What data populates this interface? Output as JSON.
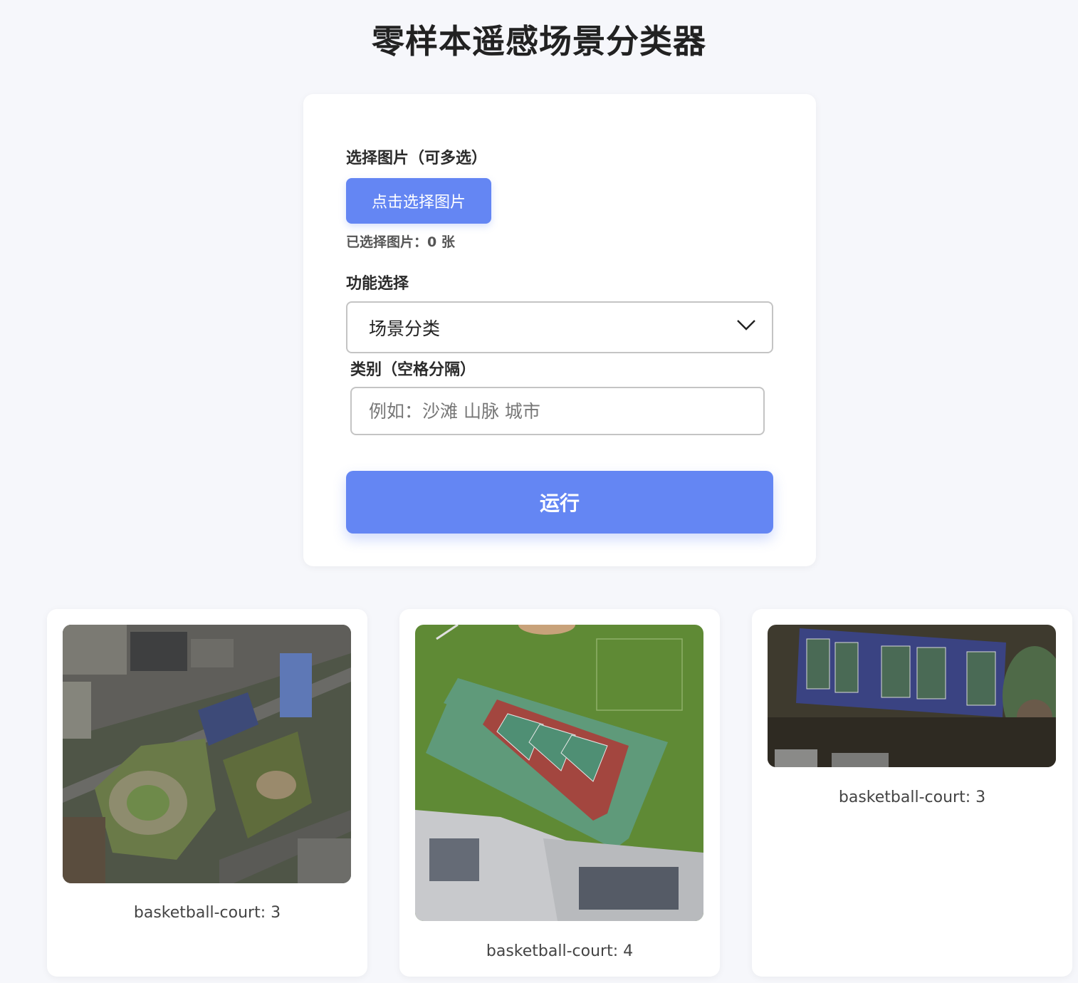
{
  "page": {
    "title": "零样本遥感场景分类器"
  },
  "form": {
    "image_label": "选择图片（可多选）",
    "upload_button": "点击选择图片",
    "selected_count_text": "已选择图片：0 张",
    "function_label": "功能选择",
    "function_selected": "场景分类",
    "categories_label": "类别（空格分隔）",
    "categories_value": "",
    "categories_placeholder": "例如：沙滩 山脉 城市",
    "run_button": "运行"
  },
  "results": [
    {
      "label": "basketball-court: 3"
    },
    {
      "label": "basketball-court: 4"
    },
    {
      "label": "basketball-court: 3"
    }
  ],
  "colors": {
    "accent": "#6486f3",
    "background": "#f6f7fb",
    "card": "#ffffff"
  }
}
